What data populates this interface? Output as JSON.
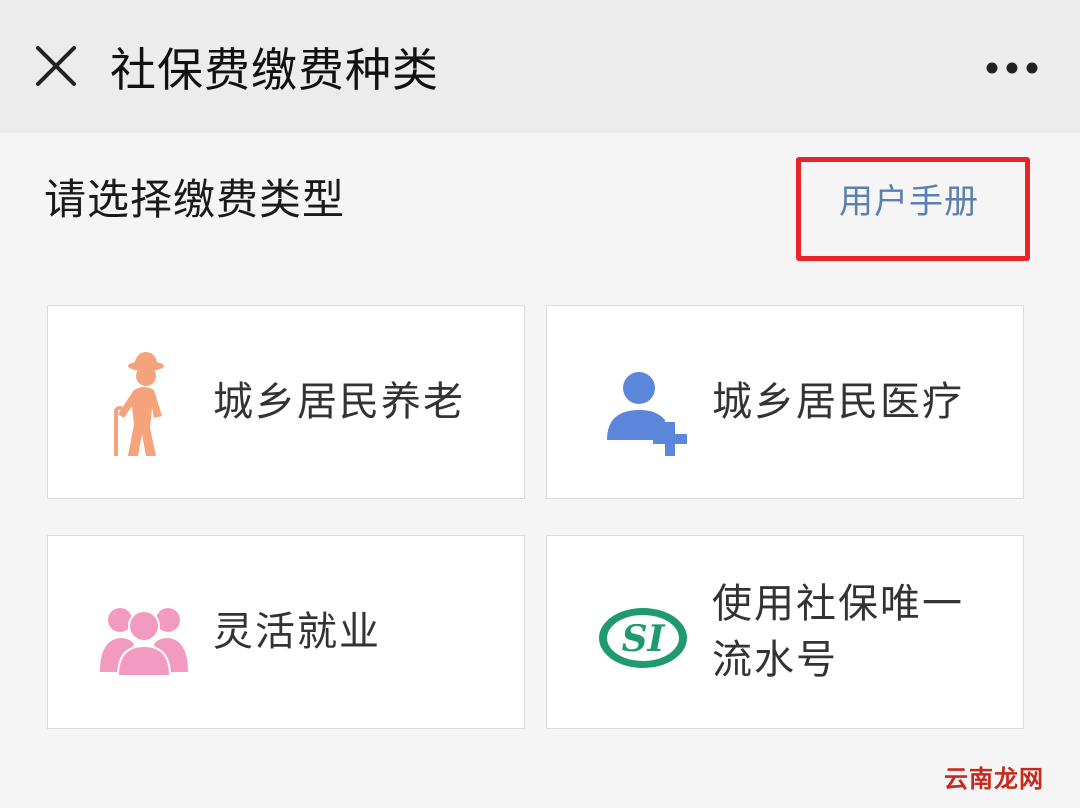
{
  "header": {
    "title": "社保费缴费种类",
    "close_icon": "close-icon",
    "more_icon": "more-dots-icon"
  },
  "section": {
    "prompt": "请选择缴费类型",
    "manual_link": "用户手册",
    "highlight_color": "#e8232a",
    "link_color": "#5b7fb0"
  },
  "cards": [
    {
      "label": "城乡居民养老",
      "icon": "elderly-person-icon",
      "icon_color": "#f4a37a"
    },
    {
      "label": "城乡居民医疗",
      "icon": "add-person-icon",
      "icon_color": "#5b86d9"
    },
    {
      "label": "灵活就业",
      "icon": "group-people-icon",
      "icon_color": "#f29ac0"
    },
    {
      "label": "使用社保唯一流水号",
      "label_line1": "使用社保唯一",
      "label_line2": "流水号",
      "icon": "social-insurance-logo",
      "icon_color": "#1f9a6e"
    }
  ],
  "watermark": "云南龙网"
}
